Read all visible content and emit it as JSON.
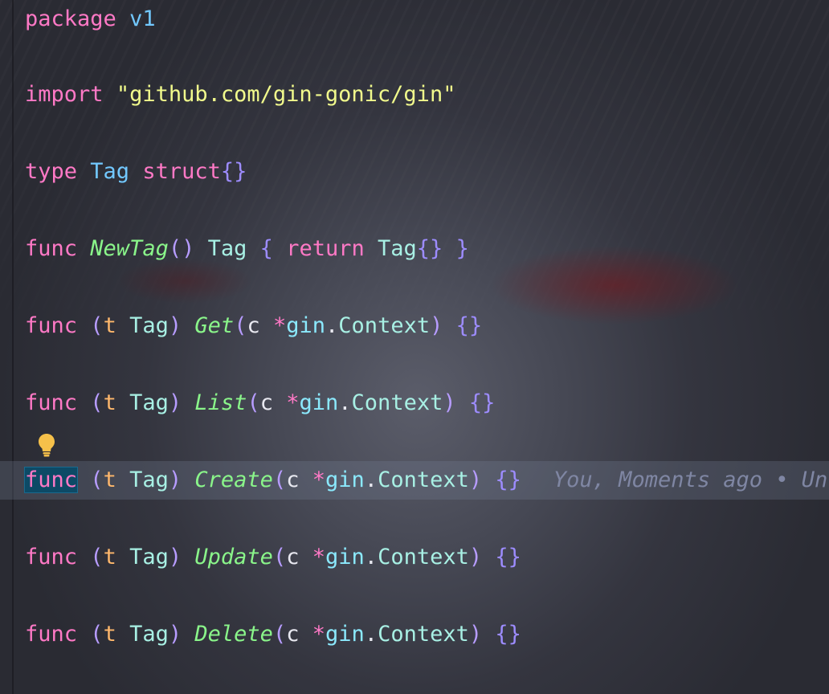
{
  "editor": {
    "lines": {
      "l1": {
        "kw": "package",
        "name": "v1"
      },
      "l2": {
        "kw": "import",
        "path": "\"github.com/gin-gonic/gin\""
      },
      "l3": {
        "kw": "type",
        "name": "Tag",
        "kw2": "struct",
        "braces": "{}"
      },
      "l4": {
        "kw": "func",
        "fn": "NewTag",
        "parens": "()",
        "type": "Tag",
        "open": "{",
        "ret": "return",
        "lit": "Tag",
        "litbraces": "{}",
        "close": "}"
      },
      "l5": {
        "kw": "func",
        "recv": "t",
        "recvtype": "Tag",
        "fn": "Get",
        "arg": "c",
        "ptr": "*",
        "pkg": "gin",
        "dot": ".",
        "argtype": "Context",
        "body": "{}"
      },
      "l6": {
        "kw": "func",
        "recv": "t",
        "recvtype": "Tag",
        "fn": "List",
        "arg": "c",
        "ptr": "*",
        "pkg": "gin",
        "dot": ".",
        "argtype": "Context",
        "body": "{}"
      },
      "l7": {
        "kw": "func",
        "recv": "t",
        "recvtype": "Tag",
        "fn": "Create",
        "arg": "c",
        "ptr": "*",
        "pkg": "gin",
        "dot": ".",
        "argtype": "Context",
        "body": "{}",
        "blame": "You, Moments ago • Uncommi"
      },
      "l8": {
        "kw": "func",
        "recv": "t",
        "recvtype": "Tag",
        "fn": "Update",
        "arg": "c",
        "ptr": "*",
        "pkg": "gin",
        "dot": ".",
        "argtype": "Context",
        "body": "{}"
      },
      "l9": {
        "kw": "func",
        "recv": "t",
        "recvtype": "Tag",
        "fn": "Delete",
        "arg": "c",
        "ptr": "*",
        "pkg": "gin",
        "dot": ".",
        "argtype": "Context",
        "body": "{}"
      }
    },
    "lightbulb_icon": "lightbulb-icon",
    "colors": {
      "keyword": "#ff79c6",
      "function": "#8af58a",
      "string": "#f1fa8c",
      "type": "#72c8ff",
      "selection": "#0d4a66"
    }
  }
}
